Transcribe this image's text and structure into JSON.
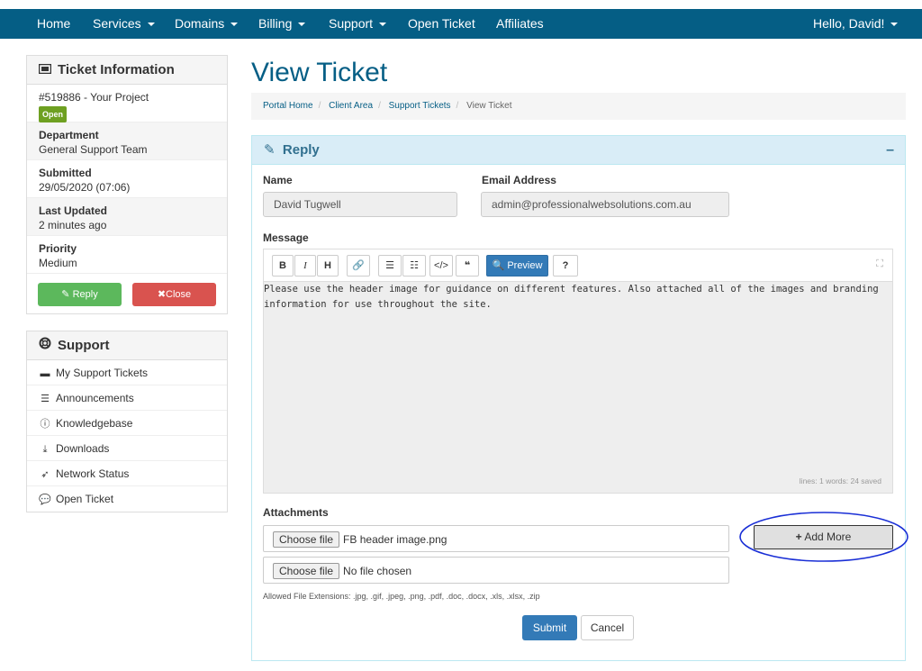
{
  "nav": {
    "home": "Home",
    "services": "Services",
    "domains": "Domains",
    "billing": "Billing",
    "support": "Support",
    "open_ticket": "Open Ticket",
    "affiliates": "Affiliates",
    "user": "Hello, David!"
  },
  "ticket_info": {
    "title": "Ticket Information",
    "ticket": "#519886 - Your Project",
    "status": "Open",
    "department_label": "Department",
    "department": "General Support Team",
    "submitted_label": "Submitted",
    "submitted": "29/05/2020 (07:06)",
    "updated_label": "Last Updated",
    "updated": "2 minutes ago",
    "priority_label": "Priority",
    "priority": "Medium",
    "reply_btn": "Reply",
    "close_btn": "Close"
  },
  "support_menu": {
    "title": "Support",
    "items": [
      "My Support Tickets",
      "Announcements",
      "Knowledgebase",
      "Downloads",
      "Network Status",
      "Open Ticket"
    ]
  },
  "page": {
    "title": "View Ticket",
    "breadcrumb": [
      "Portal Home",
      "Client Area",
      "Support Tickets",
      "View Ticket"
    ]
  },
  "reply": {
    "title": "Reply",
    "name_label": "Name",
    "name": "David Tugwell",
    "email_label": "Email Address",
    "email": "admin@professionalwebsolutions.com.au",
    "message_label": "Message",
    "preview_btn": "Preview",
    "message": "Please use the header image for guidance on different features. Also attached all of the images and branding information for use throughout the site.",
    "status": "lines: 1  words: 24  saved",
    "attachments_label": "Attachments",
    "choose_file": "Choose file",
    "file1": "FB header image.png",
    "file2": "No file chosen",
    "add_more": "Add More",
    "allowed": "Allowed File Extensions: .jpg, .gif, .jpeg, .png, .pdf, .doc, .docx, .xls, .xlsx, .zip",
    "submit": "Submit",
    "cancel": "Cancel"
  },
  "colors": {
    "nav_bg": "#055e85",
    "reply_green": "#5cb85c",
    "close_red": "#d9534f",
    "primary_blue": "#337ab7",
    "annotation_circle": "#1a2fd6"
  }
}
